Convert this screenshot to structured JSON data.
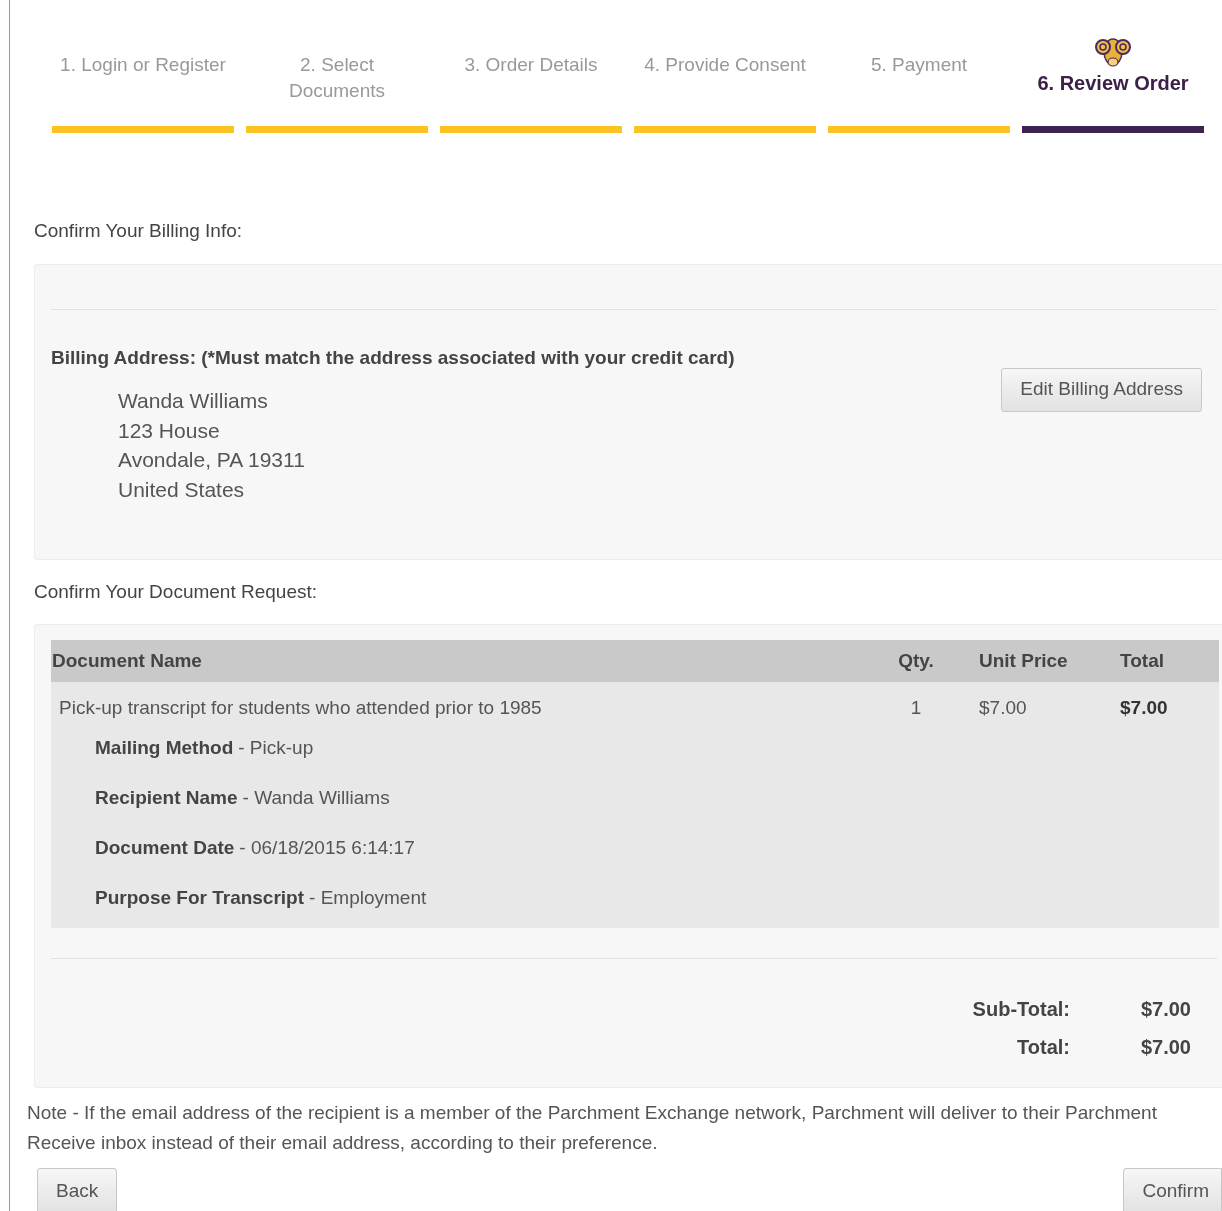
{
  "steps": [
    {
      "label": "1. Login or Register",
      "selected": false
    },
    {
      "label": "2. Select Documents",
      "selected": false
    },
    {
      "label": "3. Order Details",
      "selected": false
    },
    {
      "label": "4. Provide Consent",
      "selected": false
    },
    {
      "label": "5. Payment",
      "selected": false
    },
    {
      "label": "6. Review Order",
      "selected": true
    }
  ],
  "billing": {
    "heading": "Confirm Your Billing Info:",
    "address_label": "Billing Address: (*Must match the address associated with your credit card)",
    "address_lines": [
      "Wanda Williams",
      "123 House",
      "Avondale, PA 19311",
      "United States"
    ],
    "edit_button": "Edit Billing Address"
  },
  "request": {
    "heading": "Confirm Your Document Request:",
    "table": {
      "columns": [
        "Document Name",
        "Qty.",
        "Unit Price",
        "Total"
      ],
      "rows": [
        {
          "name": "Pick-up transcript for students who attended prior to 1985",
          "qty": "1",
          "unit_price": "$7.00",
          "total": "$7.00",
          "details": [
            {
              "label": "Mailing Method",
              "value": "- Pick-up"
            },
            {
              "label": "Recipient Name",
              "value": "- Wanda Williams"
            },
            {
              "label": "Document Date",
              "value": "- 06/18/2015 6:14:17"
            },
            {
              "label": "Purpose For Transcript",
              "value": "- Employment"
            }
          ]
        }
      ]
    },
    "summary": [
      {
        "label": "Sub-Total:",
        "value": "$7.00"
      },
      {
        "label": "Total:",
        "value": "$7.00"
      }
    ]
  },
  "note": "Note - If the email address of the recipient is a member of the Parchment Exchange network, Parchment will deliver to their Parchment Receive inbox instead of their email address, according to their preference.",
  "buttons": {
    "back": "Back",
    "confirm": "Confirm"
  }
}
